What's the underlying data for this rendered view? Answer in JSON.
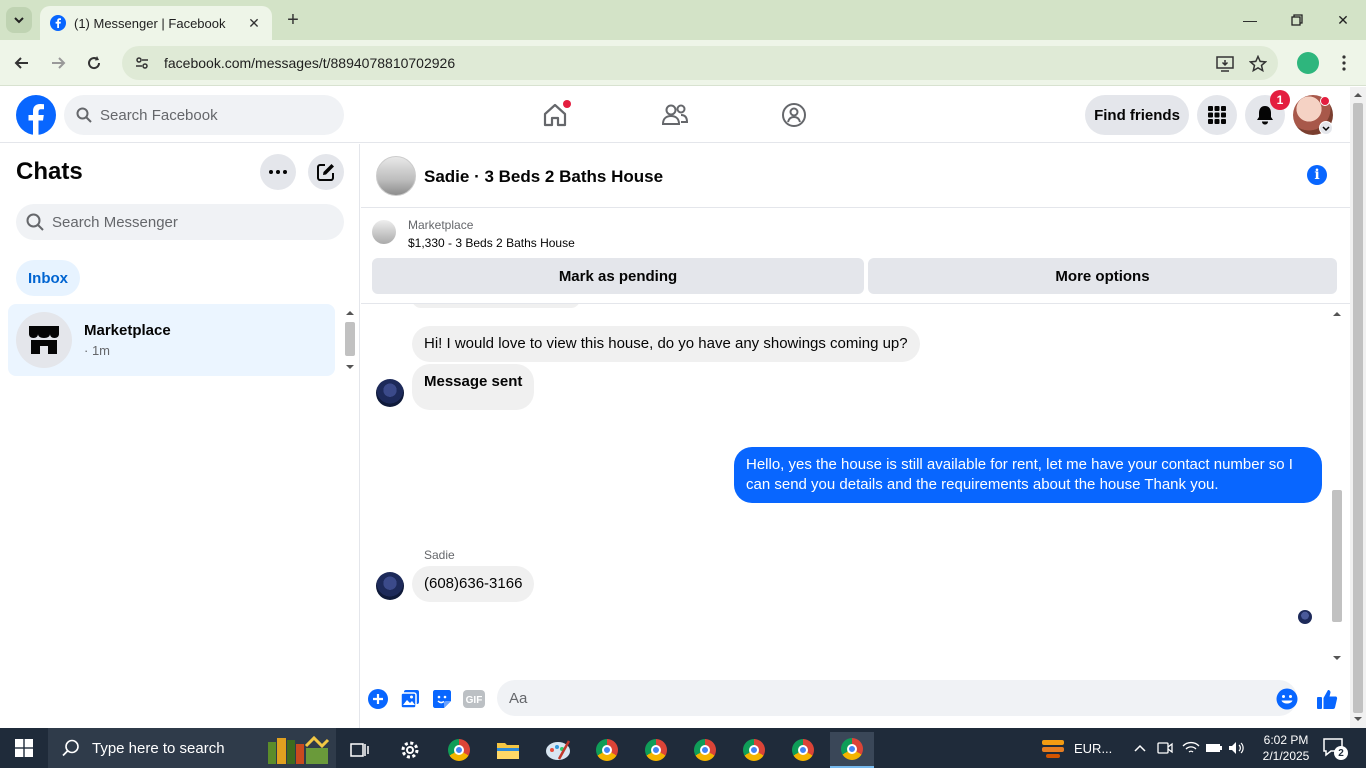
{
  "browser": {
    "tab_title": "(1) Messenger | Facebook",
    "url": "facebook.com/messages/t/8894078810702926"
  },
  "fb": {
    "search_placeholder": "Search Facebook",
    "find_friends": "Find friends",
    "notification_count": "1"
  },
  "sidebar": {
    "title": "Chats",
    "search_placeholder": "Search Messenger",
    "filter": "Inbox",
    "chats": [
      {
        "name": "Marketplace",
        "time": "· 1m"
      }
    ]
  },
  "conversation": {
    "title": "Sadie · 3 Beds 2 Baths House",
    "listing_category": "Marketplace",
    "listing_desc": "$1,330 - 3 Beds 2 Baths House",
    "mark_pending": "Mark as pending",
    "more_options": "More options",
    "messages": [
      {
        "from": "them",
        "text": "Hi! I would love to view this house, do yo have any showings coming up?"
      },
      {
        "from": "them",
        "text": "Message sent"
      },
      {
        "from": "me",
        "text": "Hello, yes the house is still available for rent, let me have your contact number so I can send you details and the requirements about the house Thank you."
      },
      {
        "from": "them",
        "sender": "Sadie",
        "text": "(608)636-3166"
      }
    ],
    "composer_placeholder": "Aa"
  },
  "taskbar": {
    "search_placeholder": "Type here to search",
    "weather": "EUR...",
    "time": "6:02 PM",
    "date": "2/1/2025",
    "notifications": "2"
  }
}
